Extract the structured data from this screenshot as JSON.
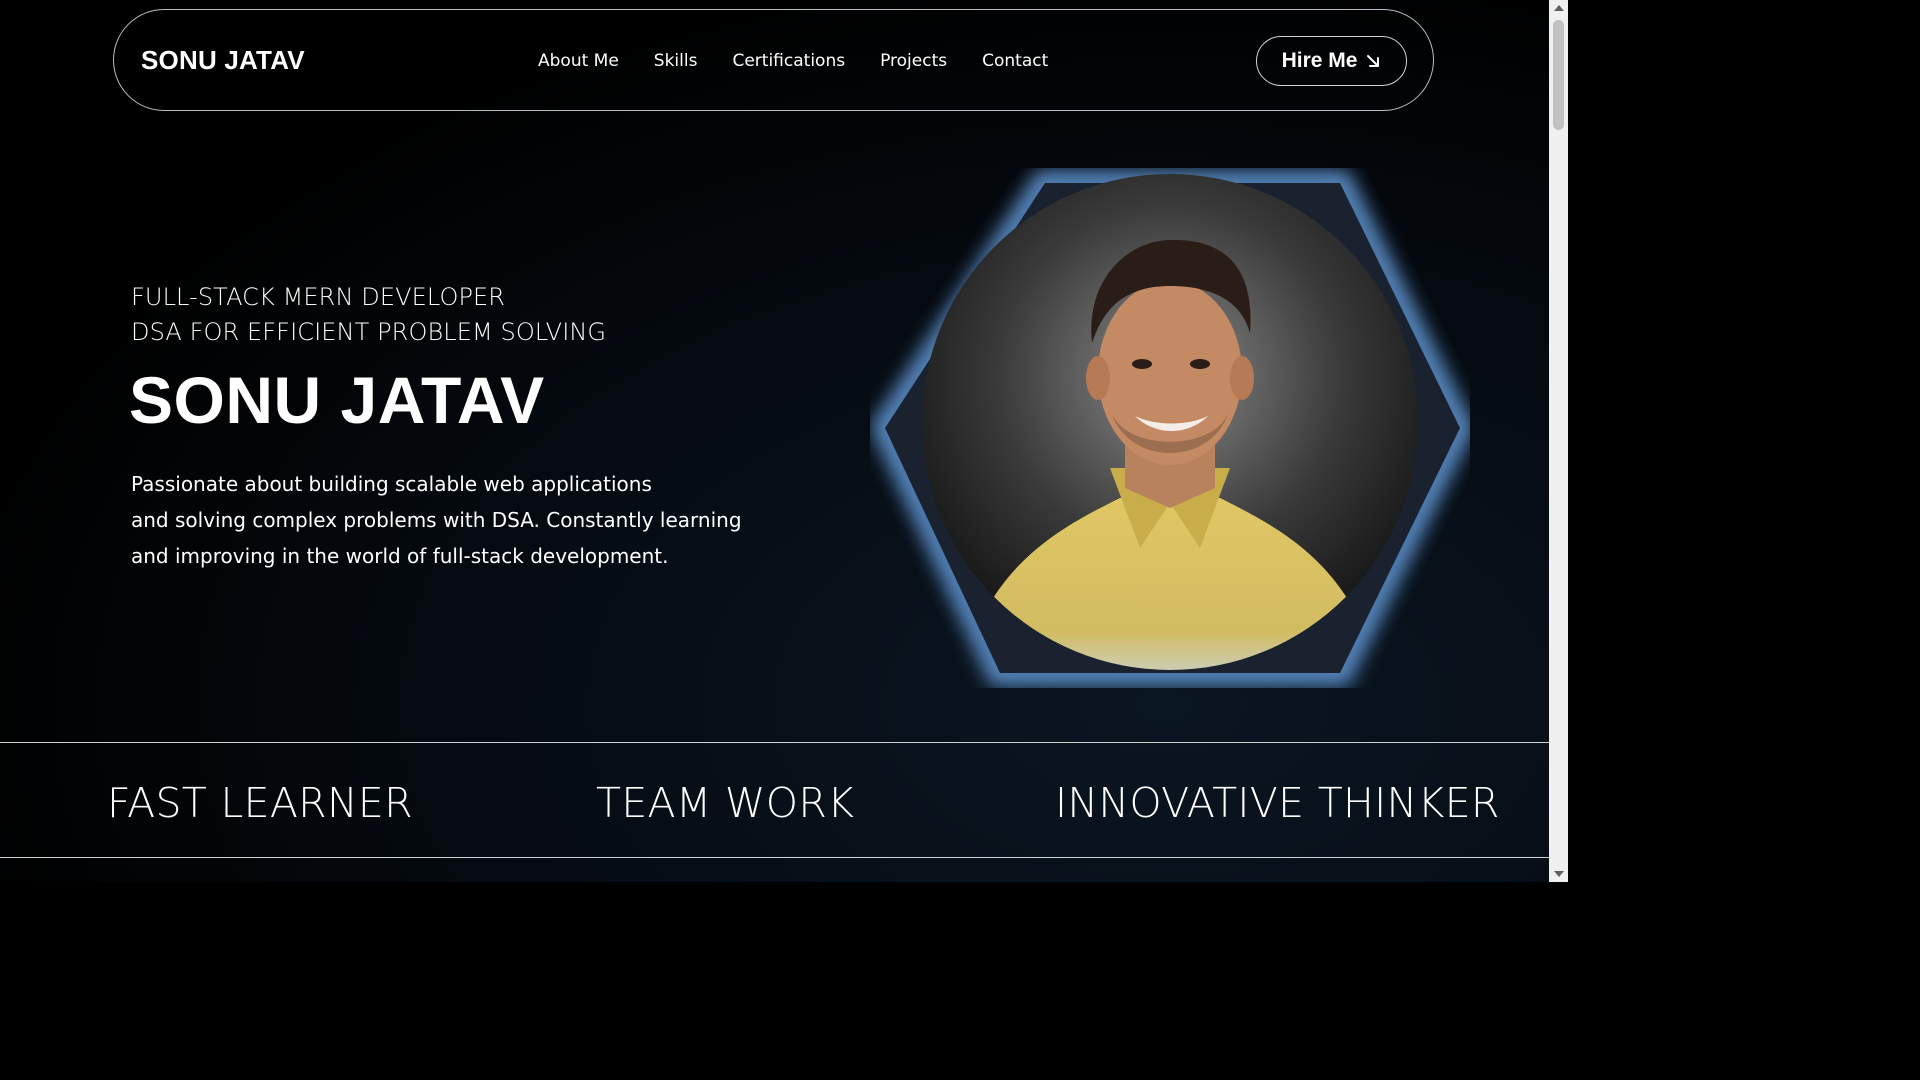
{
  "nav": {
    "brand": "SONU JATAV",
    "links": [
      "About Me",
      "Skills",
      "Certifications",
      "Projects",
      "Contact"
    ],
    "hire_label": "Hire Me"
  },
  "hero": {
    "subtitle_line1": "FULL-STACK MERN DEVELOPER",
    "subtitle_line2": "DSA FOR EFFICIENT PROBLEM SOLVING",
    "name": "SONU JATAV",
    "description_lines": [
      "Passionate about building scalable web applications",
      "and solving complex problems with DSA. Constantly learning",
      "and improving in the world of full-stack development."
    ]
  },
  "traits": [
    "FAST LEARNER",
    "TEAM WORK",
    "INNOVATIVE THINKER"
  ],
  "icons": {
    "hire": "arrow-down-right-icon"
  },
  "colors": {
    "background": "#000000",
    "glow": "#5b8fc9",
    "shirt": "#d9c25e"
  }
}
